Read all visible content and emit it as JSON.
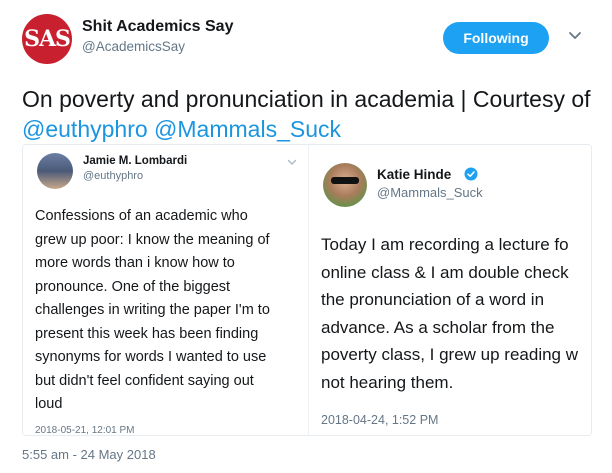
{
  "account": {
    "avatar_text": "SAS",
    "name": "Shit Academics Say",
    "handle": "@AcademicsSay",
    "follow_label": "Following"
  },
  "tweet": {
    "text_before": "On poverty and pronunciation in academia | Courtesy of ",
    "mention1": "@euthyphro",
    "mention2": "@Mammals_Suck",
    "timestamp": "5:55 am - 24 May 2018"
  },
  "left_screenshot": {
    "name": "Jamie M. Lombardi",
    "handle": "@euthyphro",
    "lines": [
      "Confessions of an academic who",
      "grew up poor: I know the meaning of",
      "more words than i know how to",
      "pronounce. One of the biggest",
      "challenges in writing the paper I'm to",
      "present this week has been finding",
      "synonyms for words I wanted to use",
      "but didn't feel confident saying out",
      "loud"
    ],
    "date": "2018-05-21, 12:01 PM"
  },
  "right_screenshot": {
    "name": "Katie Hinde",
    "handle": "@Mammals_Suck",
    "lines": [
      "Today I am recording a lecture fo",
      "online class & I am double check",
      "the pronunciation of a word in",
      "advance. As a scholar from the",
      "poverty class, I grew up reading w",
      "not hearing them."
    ],
    "date": "2018-04-24, 1:52 PM"
  },
  "colors": {
    "brand_red": "#c8202f",
    "twitter_blue": "#1da1f2",
    "mention_blue": "#1b95e0",
    "muted": "#657786"
  }
}
